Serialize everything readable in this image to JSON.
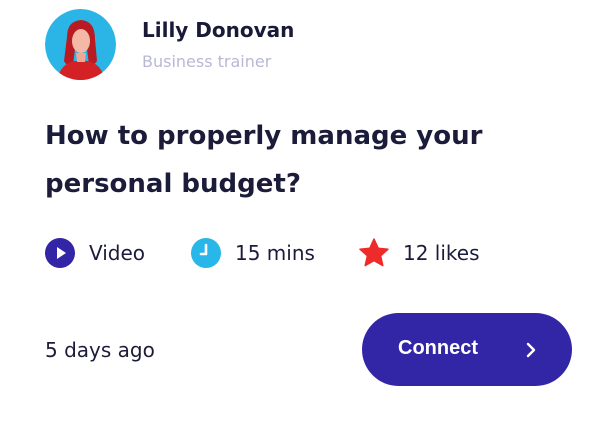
{
  "author": {
    "name": "Lilly Donovan",
    "role": "Business trainer"
  },
  "card": {
    "title": "How to properly manage your personal budget?",
    "meta": {
      "type": "Video",
      "duration": "15 mins",
      "likes": "12 likes"
    },
    "posted": "5 days ago",
    "connect_label": "Connect"
  },
  "colors": {
    "accent": "#3326a6",
    "video_icon": "#3326a6",
    "clock_icon": "#29b6e8",
    "star_icon": "#ee2b2b",
    "avatar_bg": "#2bb5e6",
    "role_text": "#b8b8d4"
  },
  "icons": {
    "type": "play-circle-icon",
    "duration": "clock-icon",
    "likes": "star-icon",
    "connect": "chevron-right-icon"
  }
}
